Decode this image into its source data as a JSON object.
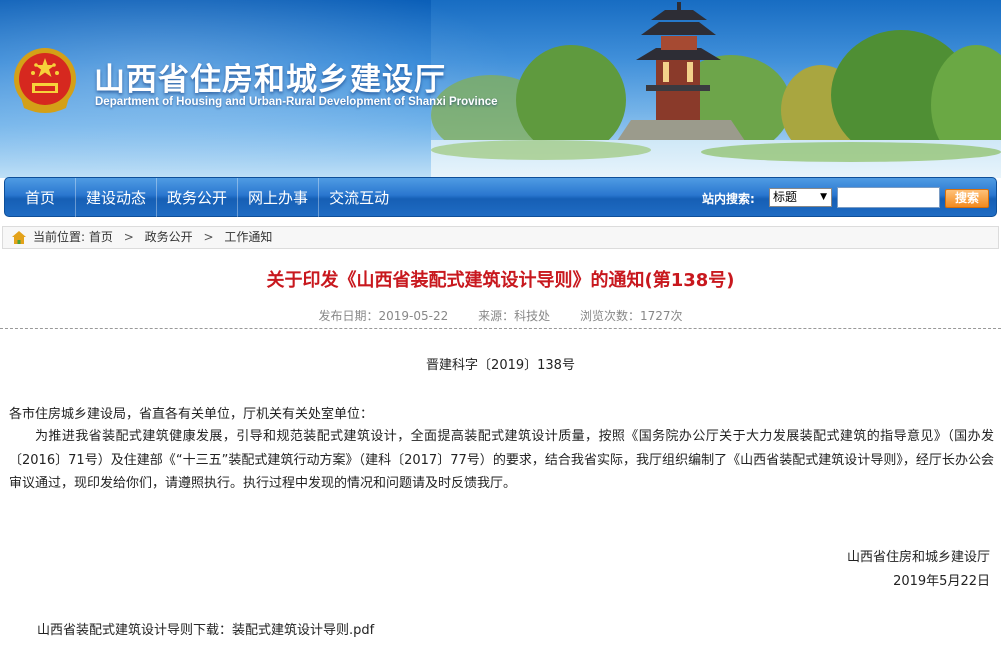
{
  "header": {
    "title": "山西省住房和城乡建设厅",
    "subtitle": "Department of Housing and Urban-Rural Development of Shanxi Province"
  },
  "nav": {
    "items": [
      {
        "label": "首页"
      },
      {
        "label": "建设动态"
      },
      {
        "label": "政务公开"
      },
      {
        "label": "网上办事"
      },
      {
        "label": "交流互动"
      }
    ],
    "search_label": "站内搜索:",
    "search_select_value": "标题",
    "search_button": "搜索"
  },
  "breadcrumb": {
    "prefix": "当前位置:",
    "items": [
      "首页",
      "政务公开",
      "工作通知"
    ],
    "separator": ">"
  },
  "article": {
    "title": "关于印发《山西省装配式建筑设计导则》的通知(第138号)",
    "publish_date": "发布日期：2019-05-22",
    "source": "来源：科技处",
    "views": "浏览次数：1727次",
    "doc_number": "晋建科字〔2019〕138号",
    "addressee": "各市住房城乡建设局，省直各有关单位，厅机关有关处室单位：",
    "body": "为推进我省装配式建筑健康发展，引导和规范装配式建筑设计，全面提高装配式建筑设计质量，按照《国务院办公厅关于大力发展装配式建筑的指导意见》（国办发〔2016〕71号）及住建部《“十三五”装配式建筑行动方案》（建科〔2017〕77号）的要求，结合我省实际，我厅组织编制了《山西省装配式建筑设计导则》，经厅长办公会审议通过，现印发给你们，请遵照执行。执行过程中发现的情况和问题请及时反馈我厅。",
    "signature_org": "山西省住房和城乡建设厅",
    "signature_date": "2019年5月22日",
    "download_label": "山西省装配式建筑设计导则下载：",
    "download_file": "装配式建筑设计导则.pdf"
  },
  "colors": {
    "title_red": "#c8181e",
    "nav_blue": "#2a77cf",
    "search_orange": "#f28a1f"
  },
  "icons": {
    "emblem": "national-emblem-icon",
    "home": "home-icon",
    "select_caret": "caret-down-icon"
  }
}
